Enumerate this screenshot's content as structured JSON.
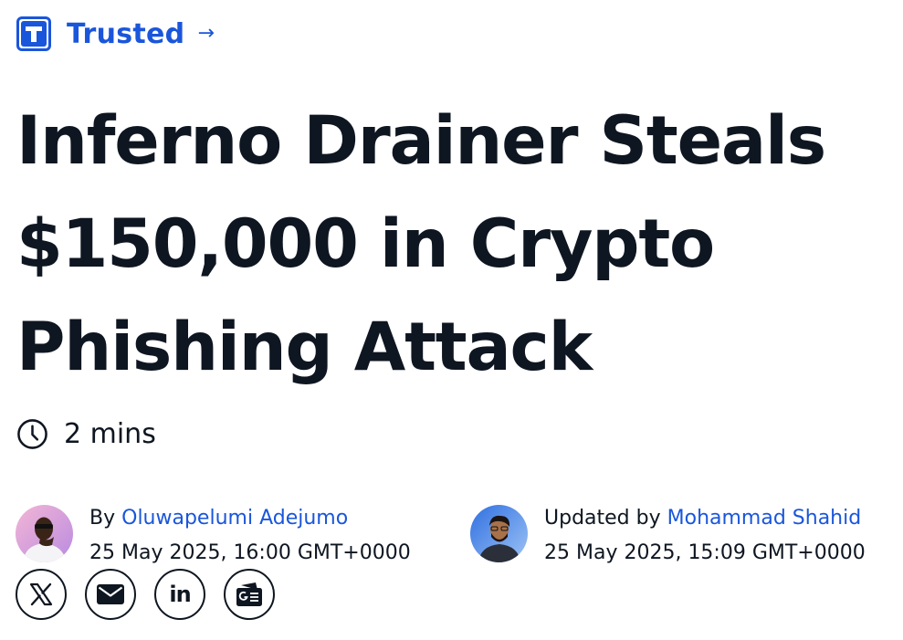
{
  "badge": {
    "label": "Trusted",
    "logo_letter": "T",
    "icon": "arrow-right-icon"
  },
  "article": {
    "title_lines": [
      "Inferno Drainer Steals",
      "$150,000 in Crypto",
      "Phishing Attack"
    ],
    "read_time": "2 mins"
  },
  "author": {
    "prefix": "By",
    "name": "Oluwapelumi Adejumo",
    "date": "25 May 2025, 16:00 GMT+0000"
  },
  "updater": {
    "prefix": "Updated by",
    "name": "Mohammad Shahid",
    "date": "25 May 2025, 15:09 GMT+0000"
  },
  "share": {
    "linkedin_label": "in",
    "icons": [
      "x-icon",
      "mail-icon",
      "linkedin-icon",
      "google-news-icon"
    ]
  },
  "colors": {
    "brand": "#1a56db",
    "text": "#0e1621",
    "background": "#ffffff"
  }
}
